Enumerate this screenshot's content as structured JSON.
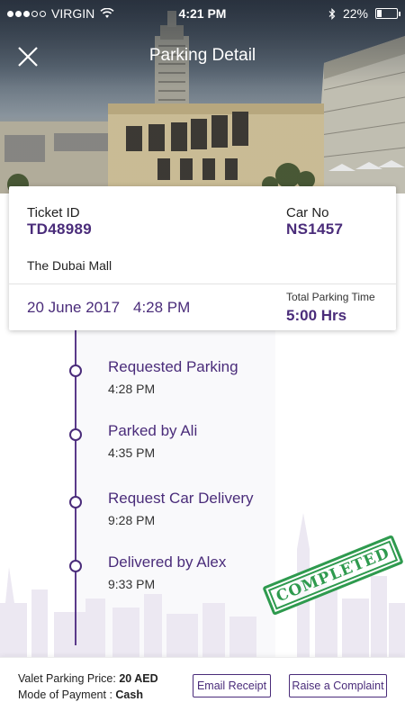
{
  "status_bar": {
    "carrier": "VIRGIN",
    "time": "4:21 PM",
    "battery": "22%",
    "battery_level": 0.22,
    "signal_bars": 3,
    "signal_total": 5
  },
  "header": {
    "title": "Parking Detail",
    "close_icon": "close-icon",
    "background": "dubai-mall-photo"
  },
  "ticket": {
    "ticket_id_label": "Ticket ID",
    "ticket_id": "TD48989",
    "car_no_label": "Car No",
    "car_no": "NS1457",
    "location": "The Dubai Mall",
    "date": "20 June 2017",
    "time": "4:28 PM",
    "total_time_label": "Total Parking Time",
    "total_time": "5:00 Hrs"
  },
  "timeline": [
    {
      "title": "Requested Parking",
      "time": "4:28 PM"
    },
    {
      "title": "Parked by Ali",
      "time": "4:35 PM"
    },
    {
      "title": "Request Car Delivery",
      "time": "9:28 PM"
    },
    {
      "title": "Delivered by Alex",
      "time": "9:33 PM"
    }
  ],
  "stamp": "COMPLETED",
  "footer": {
    "price_label": "Valet Parking Price:",
    "price": "20 AED",
    "payment_label": "Mode of Payment :",
    "payment": "Cash",
    "email_button": "Email Receipt",
    "complaint_button": "Raise a Complaint"
  },
  "colors": {
    "accent": "#4a2c7a",
    "stamp": "#2e9a4e"
  }
}
